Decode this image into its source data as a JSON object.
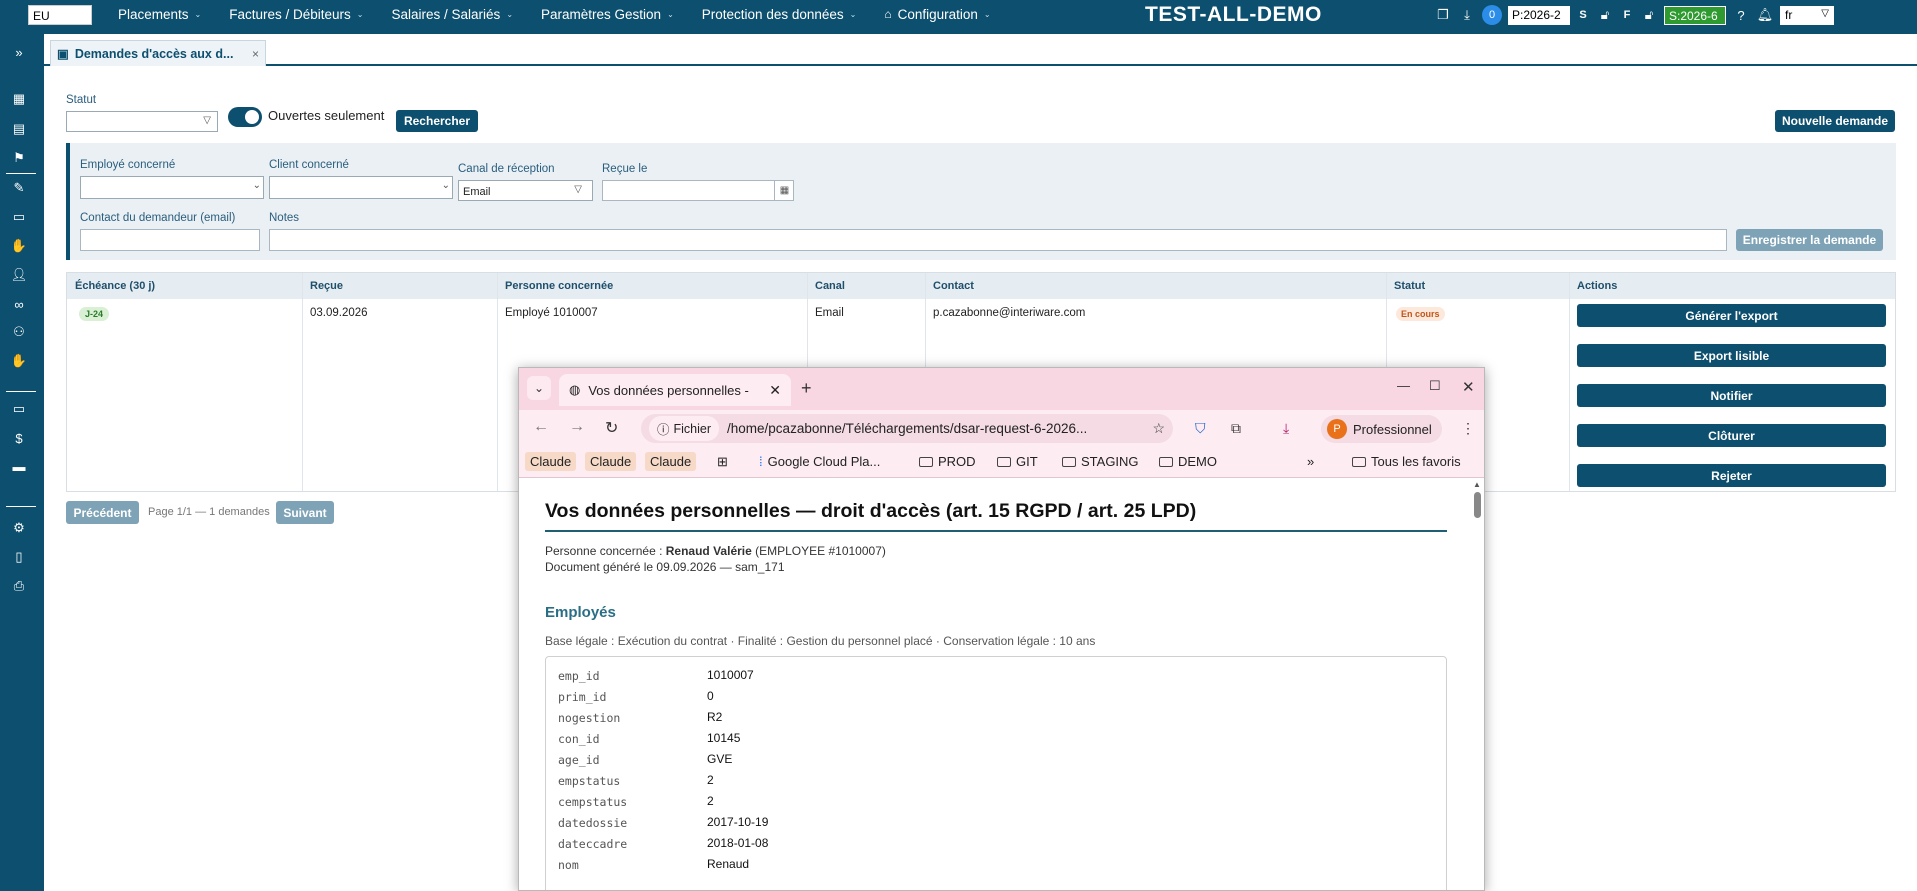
{
  "topbar": {
    "region": "EU",
    "menu": [
      {
        "label": "Placements"
      },
      {
        "label": "Factures / Débiteurs"
      },
      {
        "label": "Salaires / Salariés"
      },
      {
        "label": "Paramètres Gestion"
      },
      {
        "label": "Protection des données"
      },
      {
        "label": "Configuration"
      }
    ],
    "app_title": "TEST-ALL-DEMO",
    "notif_count": "0",
    "period_p": "P:2026-2",
    "letter_s": "S",
    "letter_f": "F",
    "period_s": "S:2026-6",
    "lang": "fr"
  },
  "tab": {
    "label": "Demandes d'accès aux d...",
    "close": "×"
  },
  "filters": {
    "statut_label": "Statut",
    "open_only_label": "Ouvertes seulement",
    "search_button": "Rechercher",
    "new_button": "Nouvelle demande"
  },
  "form": {
    "employee_label": "Employé concerné",
    "client_label": "Client concerné",
    "channel_label": "Canal de réception",
    "channel_value": "Email",
    "received_label": "Reçue le",
    "contact_label": "Contact du demandeur (email)",
    "notes_label": "Notes",
    "save_button": "Enregistrer la demande"
  },
  "table": {
    "headers": [
      "Échéance (30 j)",
      "Reçue",
      "Personne concernée",
      "Canal",
      "Contact",
      "Statut",
      "Actions"
    ],
    "row": {
      "due": "J-24",
      "received": "03.09.2026",
      "person": "Employé 1010007",
      "channel": "Email",
      "contact": "p.cazabonne@interiware.com",
      "status": "En cours"
    },
    "actions": [
      "Générer l'export",
      "Export lisible",
      "Notifier",
      "Clôturer",
      "Rejeter"
    ]
  },
  "pager": {
    "prev": "Précédent",
    "info": "Page 1/1 — 1 demandes",
    "next": "Suivant"
  },
  "browser": {
    "tab_title": "Vos données personnelles -",
    "file_chip": "Fichier",
    "url": "/home/pcazabonne/Téléchargements/dsar-request-6-2026...",
    "profile_initial": "P",
    "profile_name": "Professionnel",
    "bookmarks": [
      "Claude",
      "Claude",
      "Claude",
      "Google Cloud Pla...",
      "PROD",
      "GIT",
      "STAGING",
      "DEMO"
    ],
    "all_bookmarks": "Tous les favoris",
    "doc": {
      "title": "Vos données personnelles — droit d'accès (art. 15 RGPD / art. 25 LPD)",
      "person_prefix": "Personne concernée : ",
      "person_name": "Renaud Valérie",
      "person_suffix": " (EMPLOYEE #1010007)",
      "generated": "Document généré le 09.09.2026 — sam_171",
      "section": "Employés",
      "legal": "Base légale : Exécution du contrat · Finalité : Gestion du personnel placé · Conservation légale : 10 ans",
      "fields": [
        {
          "k": "emp_id",
          "v": "1010007"
        },
        {
          "k": "prim_id",
          "v": "0"
        },
        {
          "k": "nogestion",
          "v": "R2"
        },
        {
          "k": "con_id",
          "v": "10145"
        },
        {
          "k": "age_id",
          "v": "GVE"
        },
        {
          "k": "empstatus",
          "v": "2"
        },
        {
          "k": "cempstatus",
          "v": "2"
        },
        {
          "k": "datedossie",
          "v": "2017-10-19"
        },
        {
          "k": "dateccadre",
          "v": "2018-01-08"
        },
        {
          "k": "nom",
          "v": "Renaud"
        }
      ]
    }
  }
}
